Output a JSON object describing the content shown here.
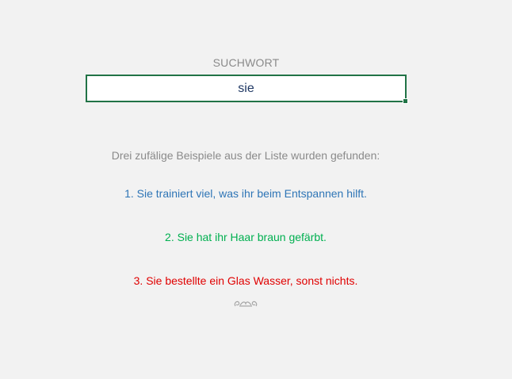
{
  "search": {
    "label": "SUCHWORT",
    "value": "sie"
  },
  "results": {
    "intro": "Drei zufälige Beispiele aus der Liste wurden gefunden:",
    "examples": [
      {
        "text": "1. Sie trainiert viel, was ihr beim Entspannen hilft.",
        "color": "#2e75b6"
      },
      {
        "text": "2. Sie hat ihr Haar braun gefärbt.",
        "color": "#00b050"
      },
      {
        "text": "3. Sie bestellte ein Glas Wasser, sonst nichts.",
        "color": "#e00000"
      }
    ]
  },
  "ornament": {
    "icon": "ornament-divider-icon",
    "color": "#a6a6a6"
  },
  "colors": {
    "background": "#f2f2f2",
    "cell_border": "#217346",
    "label_text": "#8a8a8a",
    "search_text": "#1f3864"
  }
}
